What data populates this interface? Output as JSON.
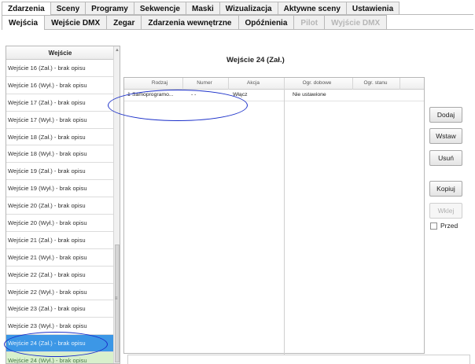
{
  "tabs_top": [
    {
      "label": "Zdarzenia",
      "active": true
    },
    {
      "label": "Sceny"
    },
    {
      "label": "Programy"
    },
    {
      "label": "Sekwencje"
    },
    {
      "label": "Maski"
    },
    {
      "label": "Wizualizacja"
    },
    {
      "label": "Aktywne sceny"
    },
    {
      "label": "Ustawienia"
    }
  ],
  "tabs_sub": [
    {
      "label": "Wejścia",
      "active": true
    },
    {
      "label": "Wejście DMX"
    },
    {
      "label": "Zegar"
    },
    {
      "label": "Zdarzenia wewnętrzne"
    },
    {
      "label": "Opóźnienia"
    },
    {
      "label": "Pilot",
      "disabled": true
    },
    {
      "label": "Wyjście DMX",
      "disabled": true
    }
  ],
  "list": {
    "header": "Wejście",
    "items": [
      "Wejście 16 (Zał.) - brak opisu",
      "Wejście 16 (Wył.) - brak opisu",
      "Wejście 17 (Zał.) - brak opisu",
      "Wejście 17 (Wył.) - brak opisu",
      "Wejście 18 (Zał.) - brak opisu",
      "Wejście 18 (Wył.) - brak opisu",
      "Wejście 19 (Zał.) - brak opisu",
      "Wejście 19 (Wył.) - brak opisu",
      "Wejście 20 (Zał.) - brak opisu",
      "Wejście 20 (Wył.) - brak opisu",
      "Wejście 21 (Zał.) - brak opisu",
      "Wejście 21 (Wył.) - brak opisu",
      "Wejście 22 (Zał.) - brak opisu",
      "Wejście 22 (Wył.) - brak opisu",
      "Wejście 23 (Zał.) - brak opisu",
      "Wejście 23 (Wył.) - brak opisu",
      "Wejście 24 (Zał.) - brak opisu",
      "Wejście 24 (Wył.) - brak opisu"
    ],
    "selected_index": 16
  },
  "main": {
    "title": "Wejście 24 (Zał.)",
    "columns": [
      "Rodzaj",
      "Numer",
      "Akcja",
      "Ogr. dobowe",
      "Ogr. stanu"
    ],
    "rows": [
      {
        "index": "1",
        "rodzaj": "Samoprogramo...",
        "numer": "- -",
        "akcja": "Włącz",
        "ogr_dobowe": "Nie ustawione",
        "ogr_stanu": ""
      }
    ]
  },
  "buttons": {
    "dodaj": "Dodaj",
    "wstaw": "Wstaw",
    "usun": "Usuń",
    "kopiuj": "Kopiuj",
    "wklej": "Wklej",
    "przed": "Przed"
  },
  "colors": {
    "selection": "#3c97e6",
    "annotation": "#1a2fc9"
  }
}
